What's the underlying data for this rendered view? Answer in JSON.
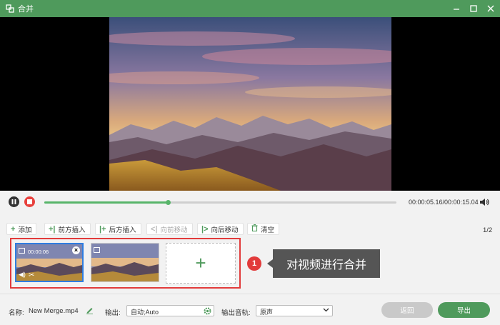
{
  "window": {
    "title": "合并",
    "icons": [
      "merge-icon",
      "minimize-icon",
      "maximize-icon",
      "close-icon"
    ]
  },
  "player": {
    "time": "00:00:05.16/00:00:15.04",
    "progress": 0.35,
    "icons": [
      "pause-icon",
      "stop-icon",
      "volume-icon"
    ]
  },
  "toolbar": {
    "add": "添加",
    "insert_before": "前方插入",
    "insert_after": "后方插入",
    "move_forward": "向前移动",
    "move_backward": "向后移动",
    "clear": "清空",
    "page": "1/2"
  },
  "clips": [
    {
      "duration": "00:00:06",
      "selected": true
    },
    {
      "duration": "",
      "selected": false
    }
  ],
  "callout": {
    "number": "1",
    "text": "对视频进行合并"
  },
  "bottom": {
    "name_label": "名称:",
    "name_value": "New Merge.mp4",
    "output_label": "输出:",
    "output_value": "自动;Auto",
    "audio_label": "输出音轨:",
    "audio_value": "原声",
    "back_label": "返回",
    "export_label": "导出"
  },
  "colors": {
    "brand_green": "#4f9a5c",
    "highlight_red": "#e23b3b",
    "selected_blue": "#2f7de0"
  }
}
